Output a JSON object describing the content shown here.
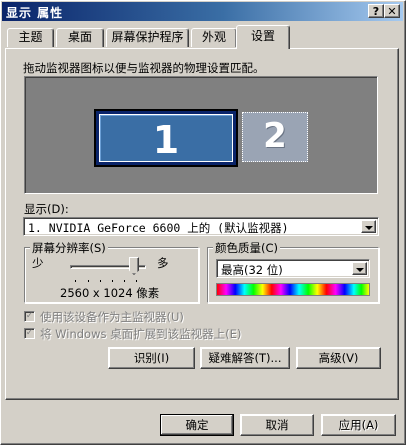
{
  "window": {
    "title": "显示 属性"
  },
  "titlebar_buttons": {
    "help": "?",
    "close": "✕"
  },
  "tabs": [
    {
      "label": "主题"
    },
    {
      "label": "桌面"
    },
    {
      "label": "屏幕保护程序"
    },
    {
      "label": "外观"
    },
    {
      "label": "设置"
    }
  ],
  "active_tab": "设置",
  "settings": {
    "description": "拖动监视器图标以便与监视器的物理设置匹配。",
    "monitors": [
      {
        "number": "1",
        "selected": true
      },
      {
        "number": "2",
        "selected": false
      }
    ],
    "display_label": "显示(D):",
    "display_value": "1. NVIDIA GeForce 6600 上的 (默认监视器)",
    "resolution": {
      "group_label": "屏幕分辨率(S)",
      "less_label": "少",
      "more_label": "多",
      "slider_position": 0.9,
      "value_text": "2560 x 1024 像素"
    },
    "color_quality": {
      "group_label": "颜色质量(C)",
      "selected": "最高(32 位)"
    },
    "checkboxes": [
      {
        "label": "使用该设备作为主监视器(U)",
        "checked": true,
        "enabled": false
      },
      {
        "label": "将 Windows 桌面扩展到该监视器上(E)",
        "checked": true,
        "enabled": false
      }
    ],
    "buttons": {
      "identify": "识别(I)",
      "troubleshoot": "疑难解答(T)...",
      "advanced": "高级(V)"
    }
  },
  "footer_buttons": {
    "ok": "确定",
    "cancel": "取消",
    "apply": "应用(A)"
  },
  "colors": {
    "title_active": "#0a246a",
    "face": "#d4d0c8",
    "monitor_selected": "#3a6ea5",
    "monitor_secondary": "#9aa4b4",
    "desktop_preview_bg": "#808080"
  }
}
